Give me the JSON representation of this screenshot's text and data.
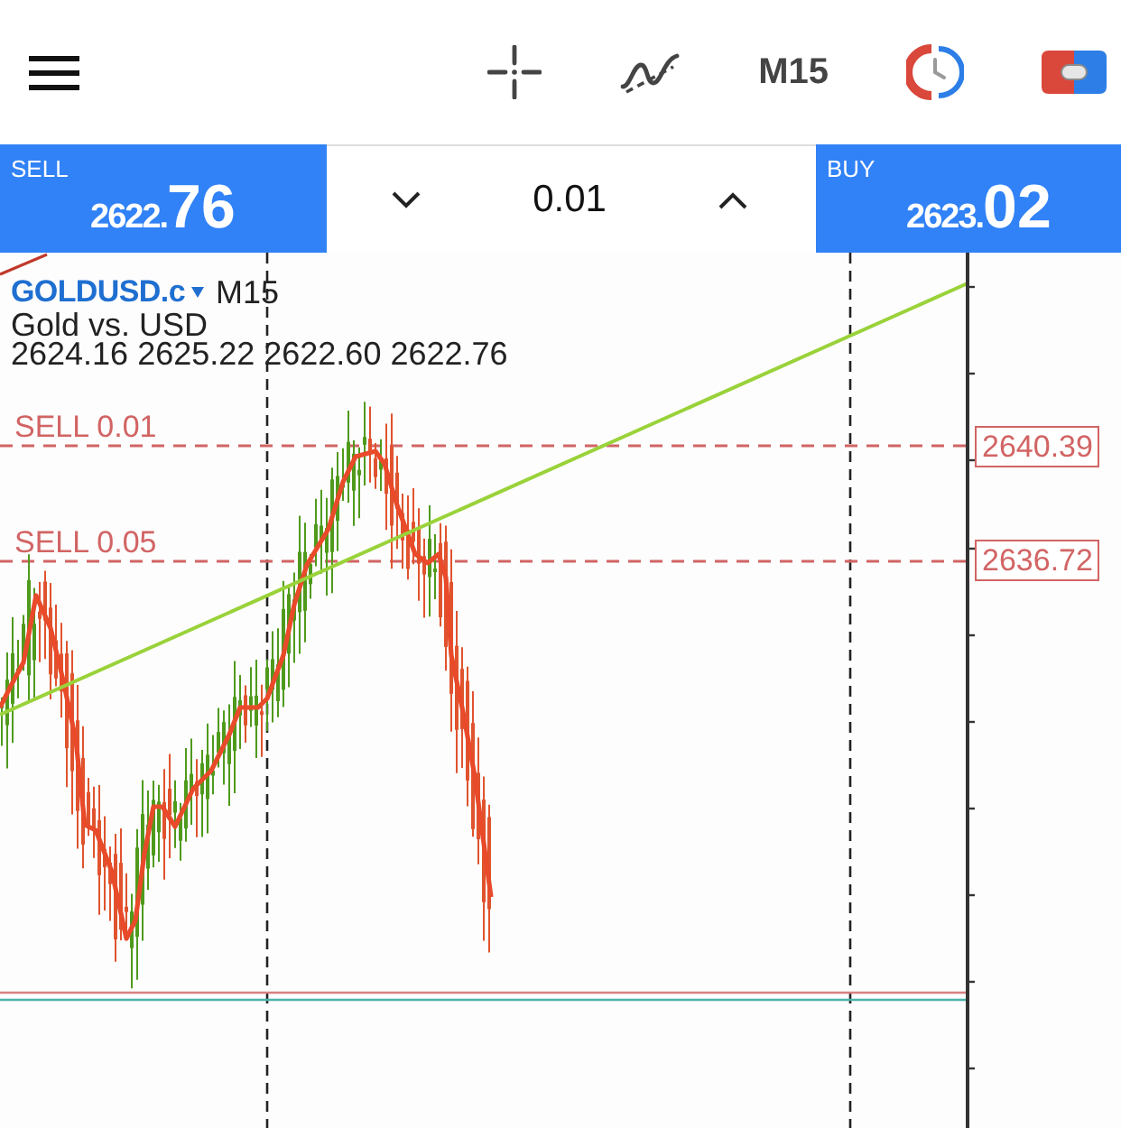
{
  "toolbar": {
    "timeframe": "M15"
  },
  "trade_bar": {
    "sell": {
      "label": "SELL",
      "price_head": "2622.",
      "price_tail": "76"
    },
    "volume": {
      "value": "0.01"
    },
    "buy": {
      "label": "BUY",
      "price_head": "2623.",
      "price_tail": "02"
    }
  },
  "chart": {
    "symbol": "GOLDUSD.c",
    "timeframe": "M15",
    "description": "Gold vs. USD",
    "quote": "2624.16 2625.22 2622.60 2622.76",
    "order_lines": [
      {
        "label": "SELL 0.01",
        "price": "2640.39"
      },
      {
        "label": "SELL 0.05",
        "price": "2636.72"
      }
    ]
  }
}
